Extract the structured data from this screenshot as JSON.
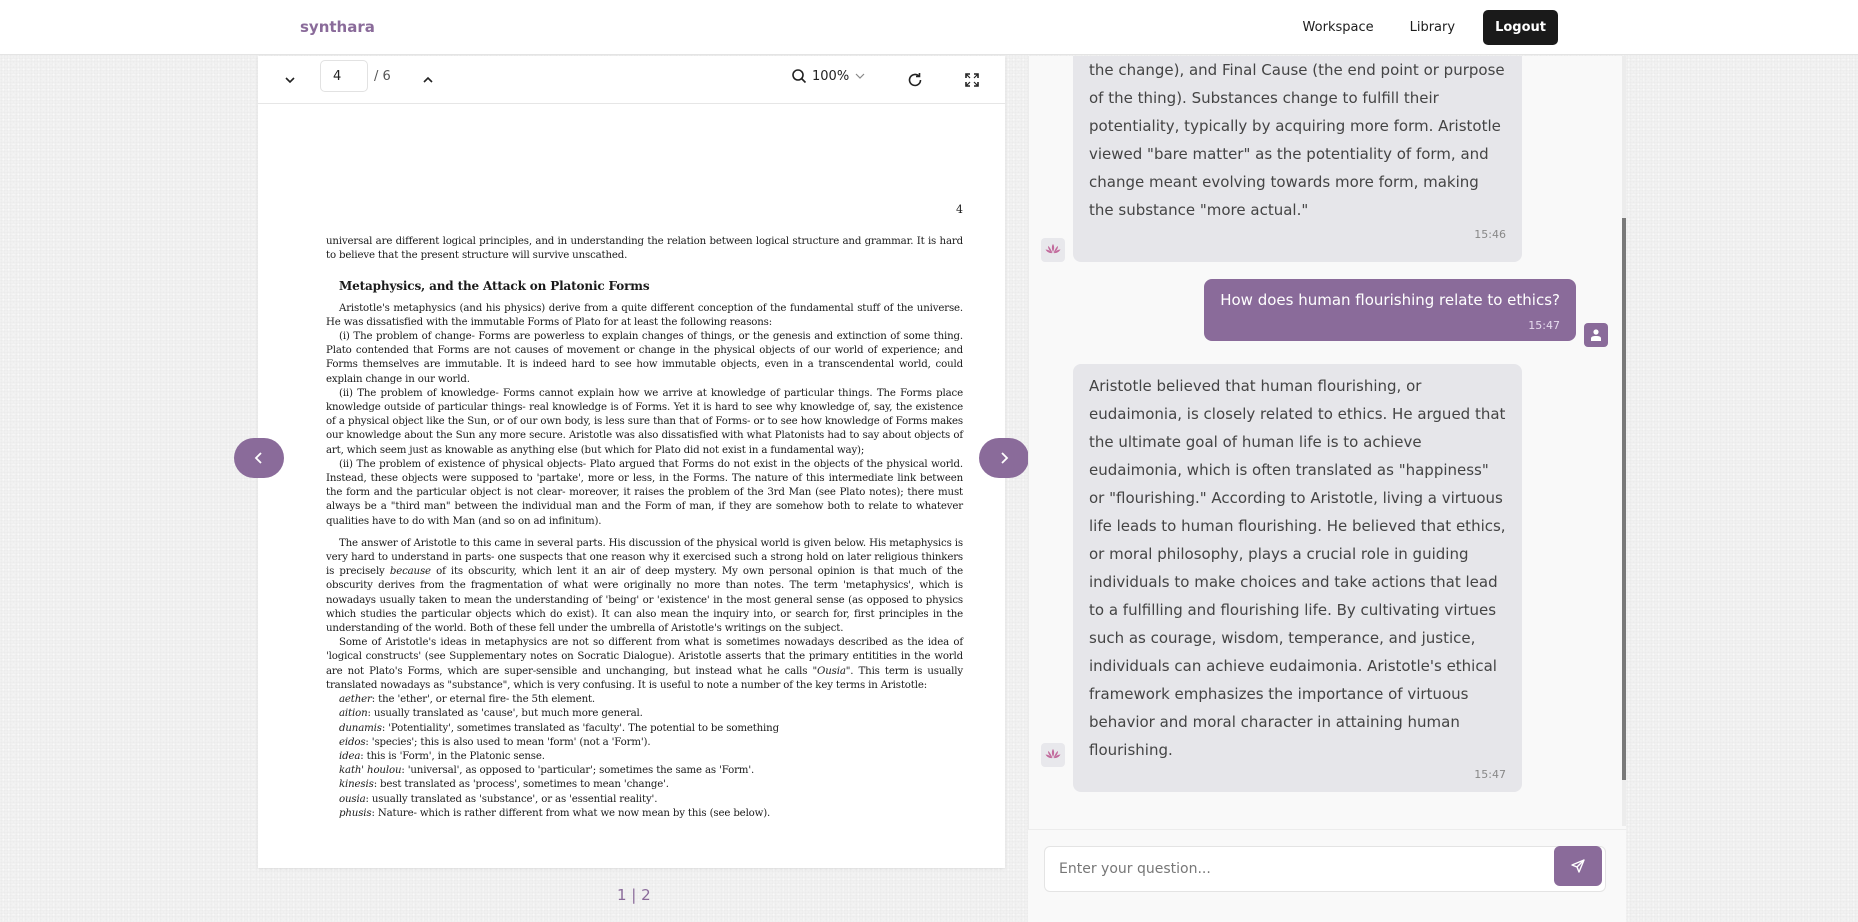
{
  "header": {
    "brand": "synthara",
    "nav": [
      "Workspace",
      "Library"
    ],
    "logout_label": "Logout"
  },
  "pdf": {
    "current_page": "4",
    "total_pages": "/ 6",
    "zoom": "100%",
    "page_number_label": "4",
    "intro_para": "universal are different logical principles, and in understanding the relation between logical structure and grammar. It is hard to believe that the present structure will survive unscathed.",
    "heading": "Metaphysics, and the Attack on Platonic Forms",
    "paras": [
      "Aristotle's metaphysics (and his physics) derive from a quite different conception of the fundamental stuff of the universe. He was dissatisfied with the immutable Forms of Plato for at least the following reasons:",
      "(i) The problem of change- Forms are powerless to explain changes of things, or the genesis and extinction of some thing. Plato contended that Forms are not causes of movement or change in the physical objects of our world of experience; and Forms themselves are immutable. It is indeed hard to see how immutable objects, even in a transcendental world, could explain change in our world.",
      "(ii) The problem of knowledge- Forms cannot explain how we arrive at knowledge of particular things. The Forms place knowledge outside of particular things- real knowledge is of Forms. Yet it is hard to see why knowledge of, say, the existence of a physical object like the Sun, or of our own body, is less sure than that of Forms- or to see how knowledge of Forms makes our knowledge about the Sun any more secure. Aristotle was also dissatisfied with what Platonists had to say about objects of art, which seem just as knowable as anything else (but which for Plato did not exist in a fundamental way);",
      "(ii) The problem of existence of physical objects- Plato argued that Forms do not exist in the objects of the physical world. Instead, these objects were supposed to 'partake', more or less, in the Forms. The nature of this intermediate link between the form and the particular object is not clear- moreover, it raises the problem of the 3rd Man (see Plato notes); there must always be a \"third man\" between the individual man and the Form of man, if they are somehow both to relate to whatever qualities have to do with Man (and so on ad infinitum)."
    ],
    "answer_para": {
      "before": "The answer of Aristotle to this came in several parts. His discussion of the physical world is given below. His metaphysics is very hard to understand in parts- one suspects that one reason why it exercised such a strong hold on later religious thinkers is precisely ",
      "emph": "because",
      "after": " of its obscurity, which lent it an air of deep mystery. My own personal opinion is that much of the obscurity derives from the fragmentation of what were originally no more than notes. The term 'metaphysics', which is nowadays usually taken to mean the understanding of 'being' or 'existence' in the most general sense (as opposed to physics which studies the particular objects which do exist). It can also mean the inquiry into, or search for, first principles in the understanding of the world. Both of these fell under the umbrella of Aristotle's writings on the subject."
    },
    "ideas_para": {
      "before": "Some of Aristotle's ideas in metaphysics are not so different from what is sometimes nowadays described as the idea of 'logical constructs' (see Supplementary notes on Socratic Dialogue). Aristotle asserts that the primary entitities in the world are not Plato's Forms, which are super-sensible and unchanging, but instead what he calls \"",
      "emph": "Ousia",
      "after": "\". This term is usually translated nowadays as \"substance\", which is very confusing. It is useful to note a number of the key terms in Aristotle:"
    },
    "terms": [
      {
        "term": "aether",
        "def": ": the 'ether', or eternal fire- the 5th element."
      },
      {
        "term": "aition",
        "def": ": usually translated as 'cause', but much more general."
      },
      {
        "term": "dunamis",
        "def": ": 'Potentiality', sometimes translated as 'faculty'. The potential to be something"
      },
      {
        "term": "eidos",
        "def": ": 'species'; this is also used to mean 'form' (not a 'Form')."
      },
      {
        "term": "idea",
        "def": ": this is 'Form', in the Platonic sense."
      },
      {
        "term": "kath' houlou",
        "def": ": 'universal', as opposed to 'particular'; sometimes the same as 'Form'."
      },
      {
        "term": "kinesis",
        "def": ": best translated as 'process', sometimes to mean 'change'."
      },
      {
        "term": "ousia",
        "def": ": usually translated as 'substance', or as 'essential reality'."
      },
      {
        "term": "phusis",
        "def": ": Nature- which is rather different from what we now mean by this (see below)."
      }
    ],
    "pager": "1 | 2"
  },
  "chat": {
    "messages": [
      {
        "role": "assistant",
        "text": "the change), and Final Cause (the end point or purpose of the thing). Substances change to fulfill their potentiality, typically by acquiring more form. Aristotle viewed \"bare matter\" as the potentiality of form, and change meant evolving towards more form, making the substance \"more actual.\"",
        "time": "15:46"
      },
      {
        "role": "user",
        "text": "How does human flourishing relate to ethics?",
        "time": "15:47"
      },
      {
        "role": "assistant",
        "text": "Aristotle believed that human flourishing, or eudaimonia, is closely related to ethics. He argued that the ultimate goal of human life is to achieve eudaimonia, which is often translated as \"happiness\" or \"flourishing.\" According to Aristotle, living a virtuous life leads to human flourishing. He believed that ethics, or moral philosophy, plays a crucial role in guiding individuals to make choices and take actions that lead to a fulfilling and flourishing life. By cultivating virtues such as courage, wisdom, temperance, and justice, individuals can achieve eudaimonia. Aristotle's ethical framework emphasizes the importance of virtuous behavior and moral character in attaining human flourishing.",
        "time": "15:47"
      }
    ],
    "input_placeholder": "Enter your question..."
  },
  "colors": {
    "accent": "#8a6b9a",
    "dark_button": "#1a1a1a",
    "bot_bubble": "#e6e6ea"
  }
}
